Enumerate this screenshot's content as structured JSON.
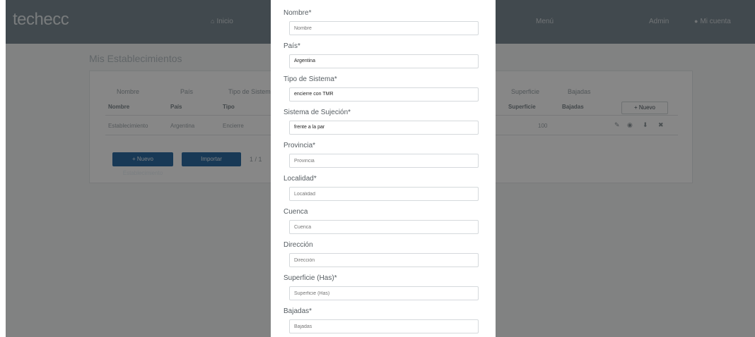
{
  "navbar": {
    "brand": "techecc",
    "home_label": "Inicio",
    "menu_label": "Menú",
    "right_link": "Admin",
    "user_label": "Mi cuenta"
  },
  "page": {
    "heading": "Mis Establecimientos",
    "tabs": [
      "Nombre",
      "País",
      "Tipo de Sistema",
      "Superficie",
      "Bajadas"
    ],
    "column_headers": [
      "Nombre",
      "País",
      "Tipo",
      "Superficie",
      "Bajadas"
    ],
    "new_button": "+ Nuevo",
    "row_cells": [
      "Establecimiento",
      "Argentina",
      "Encierre",
      "100"
    ],
    "btn_primary": "+ Nuevo Establecimiento",
    "btn_secondary": "Importar",
    "pager": "1 / 1"
  },
  "icons": {
    "home": "home-icon",
    "user": "user-icon",
    "edit": "edit-icon",
    "view": "eye-icon",
    "delete": "trash-icon"
  },
  "colors": {
    "primary": "#2f6da3",
    "navbar": "#7c8a93",
    "overlay": "rgba(0,0,0,0.47)"
  },
  "form": {
    "nombre": {
      "label": "Nombre*",
      "placeholder": "Nombre"
    },
    "pais": {
      "label": "País*",
      "value": "Argentina"
    },
    "tipo": {
      "label": "Tipo de Sistema*",
      "value": "encierre con TMR"
    },
    "sujecion": {
      "label": "Sistema de Sujeción*",
      "value": "frente a la par"
    },
    "provincia": {
      "label": "Provincia*",
      "placeholder": "Provincia"
    },
    "localidad": {
      "label": "Localidad*",
      "placeholder": "Localidad"
    },
    "cuenca": {
      "label": "Cuenca",
      "placeholder": "Cuenca"
    },
    "direccion": {
      "label": "Dirección",
      "placeholder": "Dirección"
    },
    "superficie": {
      "label": "Superficie (Has)*",
      "placeholder": "Superficie (Has)"
    },
    "bajadas": {
      "label": "Bajadas*",
      "placeholder": "Bajadas"
    }
  }
}
